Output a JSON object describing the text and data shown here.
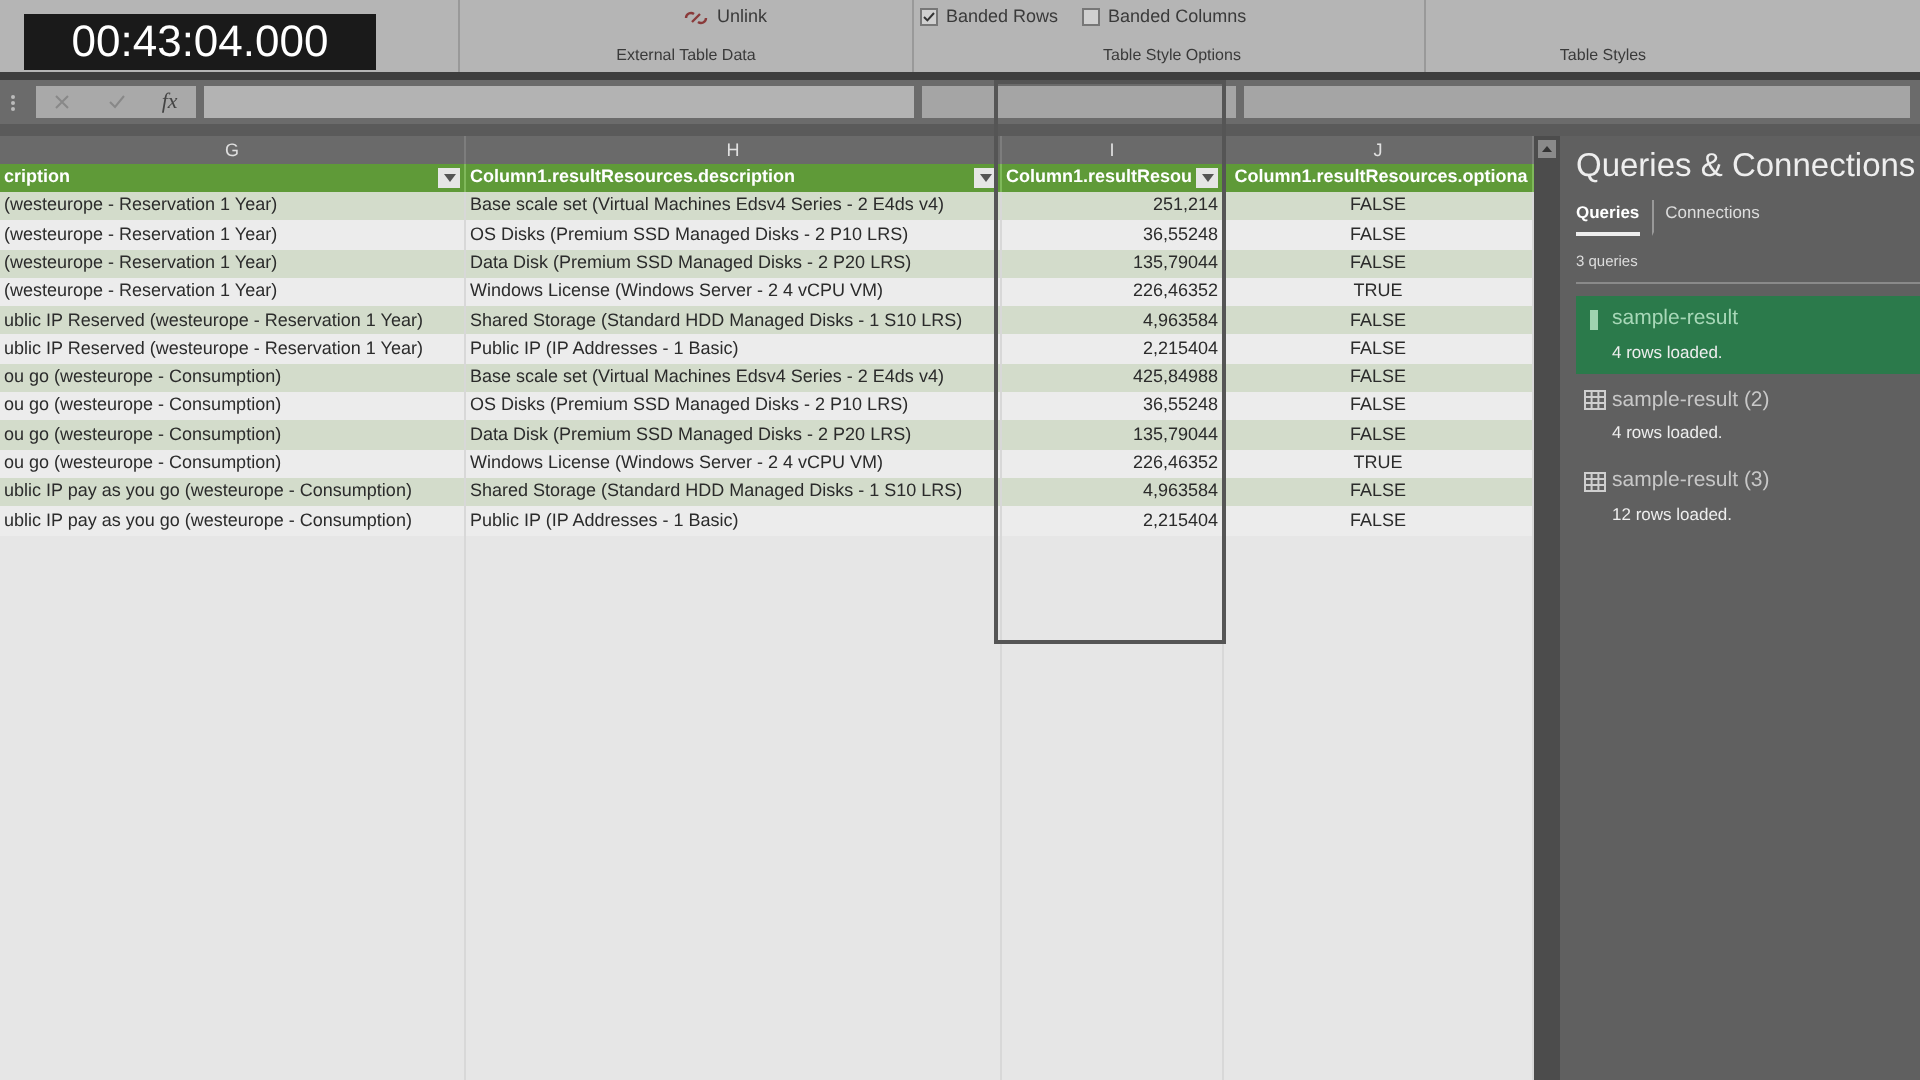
{
  "timestamp": "00:43:04.000",
  "ribbon": {
    "unlink_button": "Unlink",
    "options": [
      {
        "label": "Banded Rows",
        "checked": true
      },
      {
        "label": "Banded Columns",
        "checked": false
      }
    ],
    "groups": [
      "External Table Data",
      "Table Style Options",
      "Table Styles"
    ]
  },
  "formula_bar": {
    "function_label": "fx"
  },
  "sheet": {
    "column_letters": [
      "G",
      "H",
      "I",
      "J"
    ],
    "columns": [
      {
        "label": "cription",
        "kind": "text"
      },
      {
        "label": "Column1.resultResources.description",
        "kind": "text"
      },
      {
        "label": "Column1.resultResou",
        "kind": "number"
      },
      {
        "label": "Column1.resultResources.optiona",
        "kind": "boolean"
      }
    ],
    "rows": [
      [
        "(westeurope - Reservation 1 Year)",
        "Base scale set (Virtual Machines Edsv4 Series - 2 E4ds v4)",
        "251,214",
        "FALSE"
      ],
      [
        "(westeurope - Reservation 1 Year)",
        "OS Disks (Premium SSD Managed Disks - 2 P10 LRS)",
        "36,55248",
        "FALSE"
      ],
      [
        "(westeurope - Reservation 1 Year)",
        "Data Disk (Premium SSD Managed Disks - 2 P20 LRS)",
        "135,79044",
        "FALSE"
      ],
      [
        "(westeurope - Reservation 1 Year)",
        "Windows License (Windows Server - 2 4 vCPU VM)",
        "226,46352",
        "TRUE"
      ],
      [
        "ublic IP Reserved (westeurope - Reservation 1 Year)",
        "Shared Storage (Standard HDD Managed Disks - 1 S10 LRS)",
        "4,963584",
        "FALSE"
      ],
      [
        "ublic IP Reserved (westeurope - Reservation 1 Year)",
        "Public IP (IP Addresses - 1 Basic)",
        "2,215404",
        "FALSE"
      ],
      [
        "ou go (westeurope - Consumption)",
        "Base scale set (Virtual Machines Edsv4 Series - 2 E4ds v4)",
        "425,84988",
        "FALSE"
      ],
      [
        "ou go (westeurope - Consumption)",
        "OS Disks (Premium SSD Managed Disks - 2 P10 LRS)",
        "36,55248",
        "FALSE"
      ],
      [
        "ou go (westeurope - Consumption)",
        "Data Disk (Premium SSD Managed Disks - 2 P20 LRS)",
        "135,79044",
        "FALSE"
      ],
      [
        "ou go (westeurope - Consumption)",
        "Windows License (Windows Server - 2 4 vCPU VM)",
        "226,46352",
        "TRUE"
      ],
      [
        "ublic IP pay as you go (westeurope - Consumption)",
        "Shared Storage (Standard HDD Managed Disks - 1 S10 LRS)",
        "4,963584",
        "FALSE"
      ],
      [
        "ublic IP pay as you go (westeurope - Consumption)",
        "Public IP (IP Addresses - 1 Basic)",
        "2,215404",
        "FALSE"
      ]
    ]
  },
  "panel": {
    "title": "Queries & Connections",
    "tabs": [
      {
        "label": "Queries",
        "selected": true
      },
      {
        "label": "Connections",
        "selected": false
      }
    ],
    "count": "3 queries",
    "queries": [
      {
        "name": "sample-result",
        "status": "4 rows loaded.",
        "selected": true
      },
      {
        "name": "sample-result (2)",
        "status": "4 rows loaded.",
        "selected": false
      },
      {
        "name": "sample-result (3)",
        "status": "12 rows loaded.",
        "selected": false
      }
    ]
  }
}
